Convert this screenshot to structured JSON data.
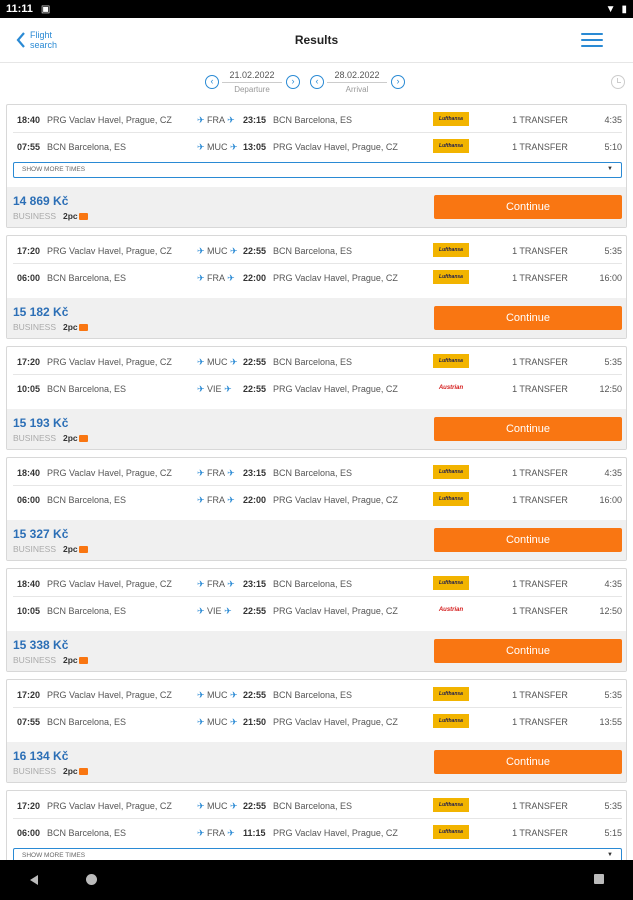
{
  "statusbar": {
    "time": "11:11"
  },
  "appbar": {
    "back_label": "Flight search",
    "title": "Results"
  },
  "dates": {
    "departure_value": "21.02.2022",
    "departure_caption": "Departure",
    "arrival_value": "28.02.2022",
    "arrival_caption": "Arrival"
  },
  "labels": {
    "show_more_times": "SHOW MORE TIMES",
    "continue": "Continue"
  },
  "results": [
    {
      "price": "14 869 Kč",
      "fare_class": "BUSINESS",
      "bags": "2pc",
      "segments": [
        {
          "dep_time": "18:40",
          "dep_place": "PRG Vaclav Havel, Prague, CZ",
          "via": "FRA",
          "arr_time": "23:15",
          "arr_place": "BCN Barcelona, ES",
          "airline": "Lufthansa",
          "transfer": "1 TRANSFER",
          "duration": "4:35"
        },
        {
          "dep_time": "07:55",
          "dep_place": "BCN Barcelona, ES",
          "via": "MUC",
          "arr_time": "13:05",
          "arr_place": "PRG Vaclav Havel, Prague, CZ",
          "airline": "Lufthansa",
          "transfer": "1 TRANSFER",
          "duration": "5:10"
        }
      ]
    },
    {
      "price": "15 182 Kč",
      "fare_class": "BUSINESS",
      "bags": "2pc",
      "segments": [
        {
          "dep_time": "17:20",
          "dep_place": "PRG Vaclav Havel, Prague, CZ",
          "via": "MUC",
          "arr_time": "22:55",
          "arr_place": "BCN Barcelona, ES",
          "airline": "Lufthansa",
          "transfer": "1 TRANSFER",
          "duration": "5:35"
        },
        {
          "dep_time": "06:00",
          "dep_place": "BCN Barcelona, ES",
          "via": "FRA",
          "arr_time": "22:00",
          "arr_place": "PRG Vaclav Havel, Prague, CZ",
          "airline": "Lufthansa",
          "transfer": "1 TRANSFER",
          "duration": "16:00"
        }
      ]
    },
    {
      "price": "15 193 Kč",
      "fare_class": "BUSINESS",
      "bags": "2pc",
      "segments": [
        {
          "dep_time": "17:20",
          "dep_place": "PRG Vaclav Havel, Prague, CZ",
          "via": "MUC",
          "arr_time": "22:55",
          "arr_place": "BCN Barcelona, ES",
          "airline": "Lufthansa",
          "transfer": "1 TRANSFER",
          "duration": "5:35"
        },
        {
          "dep_time": "10:05",
          "dep_place": "BCN Barcelona, ES",
          "via": "VIE",
          "arr_time": "22:55",
          "arr_place": "PRG Vaclav Havel, Prague, CZ",
          "airline": "Austrian",
          "transfer": "1 TRANSFER",
          "duration": "12:50"
        }
      ]
    },
    {
      "price": "15 327 Kč",
      "fare_class": "BUSINESS",
      "bags": "2pc",
      "segments": [
        {
          "dep_time": "18:40",
          "dep_place": "PRG Vaclav Havel, Prague, CZ",
          "via": "FRA",
          "arr_time": "23:15",
          "arr_place": "BCN Barcelona, ES",
          "airline": "Lufthansa",
          "transfer": "1 TRANSFER",
          "duration": "4:35"
        },
        {
          "dep_time": "06:00",
          "dep_place": "BCN Barcelona, ES",
          "via": "FRA",
          "arr_time": "22:00",
          "arr_place": "PRG Vaclav Havel, Prague, CZ",
          "airline": "Lufthansa",
          "transfer": "1 TRANSFER",
          "duration": "16:00"
        }
      ]
    },
    {
      "price": "15 338 Kč",
      "fare_class": "BUSINESS",
      "bags": "2pc",
      "segments": [
        {
          "dep_time": "18:40",
          "dep_place": "PRG Vaclav Havel, Prague, CZ",
          "via": "FRA",
          "arr_time": "23:15",
          "arr_place": "BCN Barcelona, ES",
          "airline": "Lufthansa",
          "transfer": "1 TRANSFER",
          "duration": "4:35"
        },
        {
          "dep_time": "10:05",
          "dep_place": "BCN Barcelona, ES",
          "via": "VIE",
          "arr_time": "22:55",
          "arr_place": "PRG Vaclav Havel, Prague, CZ",
          "airline": "Austrian",
          "transfer": "1 TRANSFER",
          "duration": "12:50"
        }
      ]
    },
    {
      "price": "16 134 Kč",
      "fare_class": "BUSINESS",
      "bags": "2pc",
      "segments": [
        {
          "dep_time": "17:20",
          "dep_place": "PRG Vaclav Havel, Prague, CZ",
          "via": "MUC",
          "arr_time": "22:55",
          "arr_place": "BCN Barcelona, ES",
          "airline": "Lufthansa",
          "transfer": "1 TRANSFER",
          "duration": "5:35"
        },
        {
          "dep_time": "07:55",
          "dep_place": "BCN Barcelona, ES",
          "via": "MUC",
          "arr_time": "21:50",
          "arr_place": "PRG Vaclav Havel, Prague, CZ",
          "airline": "Lufthansa",
          "transfer": "1 TRANSFER",
          "duration": "13:55"
        }
      ]
    },
    {
      "price": "",
      "fare_class": "",
      "bags": "",
      "segments": [
        {
          "dep_time": "17:20",
          "dep_place": "PRG Vaclav Havel, Prague, CZ",
          "via": "MUC",
          "arr_time": "22:55",
          "arr_place": "BCN Barcelona, ES",
          "airline": "Lufthansa",
          "transfer": "1 TRANSFER",
          "duration": "5:35"
        },
        {
          "dep_time": "06:00",
          "dep_place": "BCN Barcelona, ES",
          "via": "FRA",
          "arr_time": "11:15",
          "arr_place": "PRG Vaclav Havel, Prague, CZ",
          "airline": "Lufthansa",
          "transfer": "1 TRANSFER",
          "duration": "5:15"
        }
      ]
    }
  ]
}
